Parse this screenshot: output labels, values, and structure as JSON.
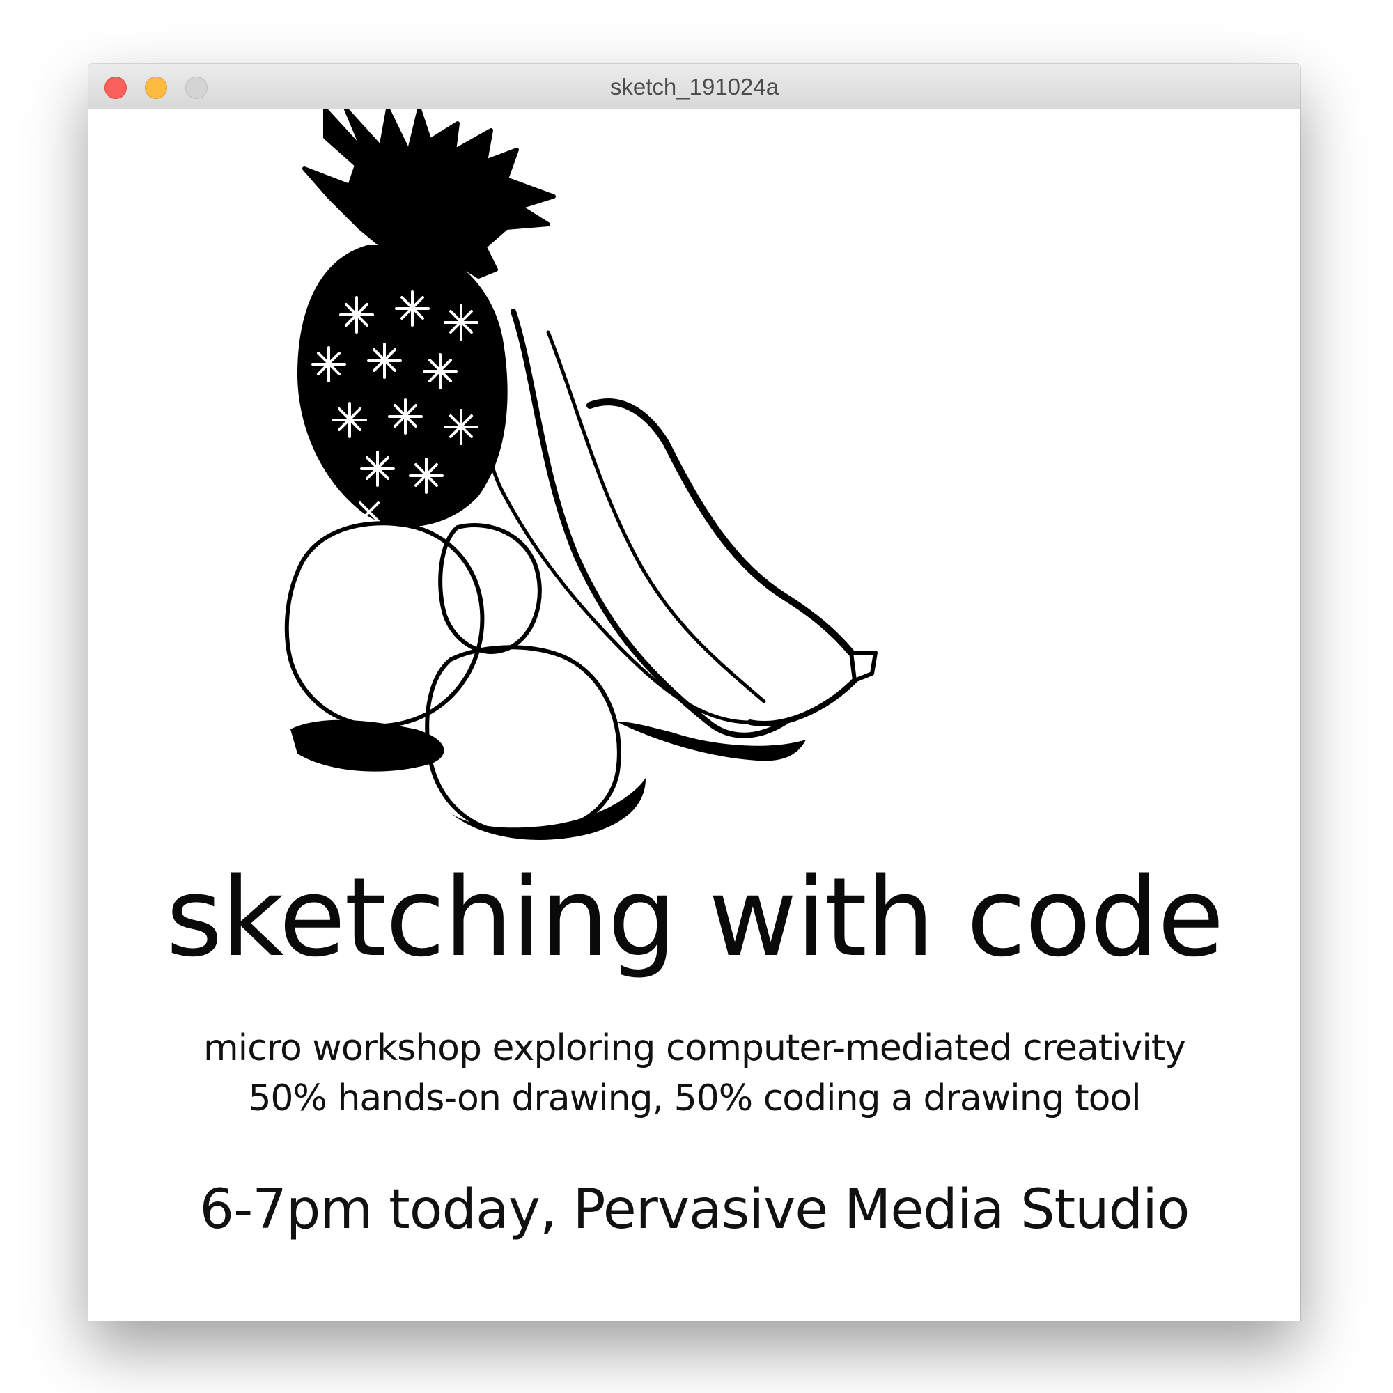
{
  "window": {
    "title": "sketch_191024a",
    "controls": {
      "close_icon": "close-icon",
      "minimize_icon": "minimize-icon",
      "maximize_icon": "maximize-icon"
    }
  },
  "canvas": {
    "illustration": "fruit-sketch",
    "headline": "sketching with code",
    "subtitle_line1": "micro workshop exploring computer-mediated creativity",
    "subtitle_line2": "50% hands-on drawing, 50% coding a drawing tool",
    "event_info": "6-7pm today, Pervasive Media Studio"
  },
  "colors": {
    "close": "#fc605c",
    "minimize": "#fdbc40",
    "maximize": "#d4d4d4",
    "ink": "#000000",
    "background": "#ffffff"
  }
}
